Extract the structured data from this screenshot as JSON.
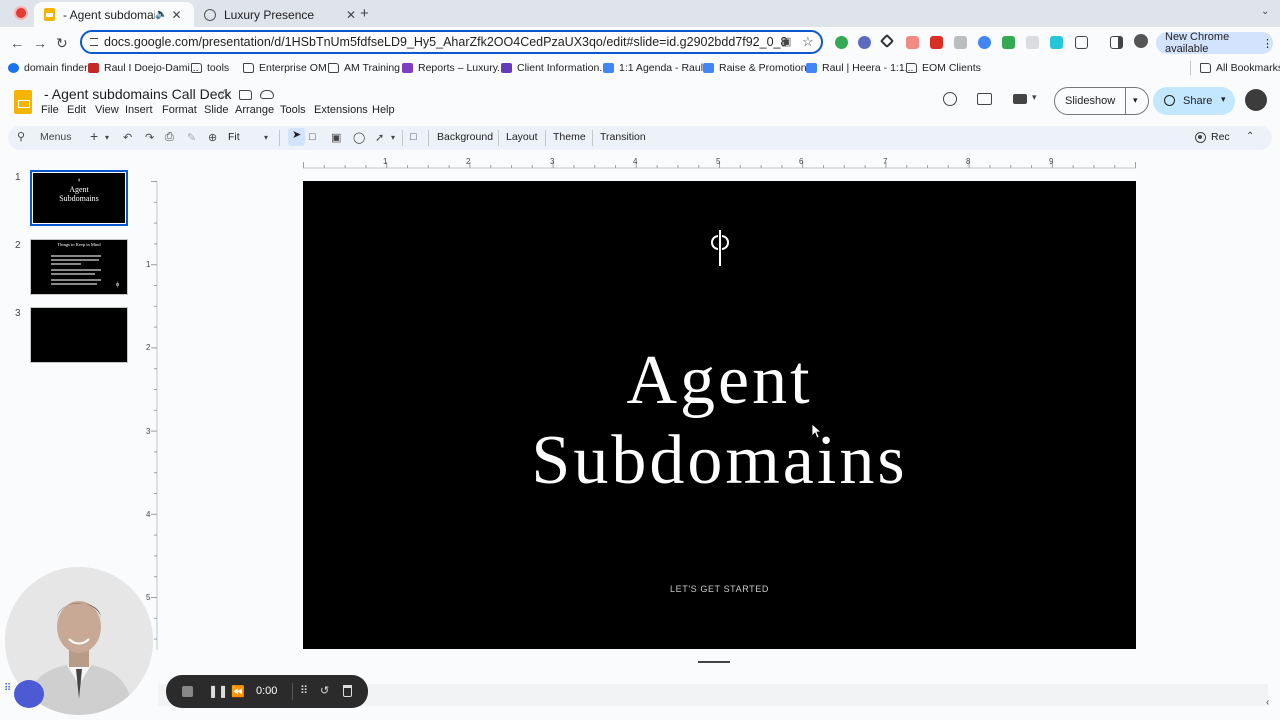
{
  "browser": {
    "tabs": [
      {
        "title": "- Agent subdomains Call",
        "active": true,
        "icon": "slides-icon",
        "extra_icon": "speaker-icon"
      },
      {
        "title": "Luxury Presence",
        "active": false,
        "icon": "globe-icon"
      }
    ],
    "url": "docs.google.com/presentation/d/1HSbTnUm5fdfseLD9_Hy5_AharZfk2OO4CedPzaUX3qo/edit#slide=id.g2902bdd7f92_0_8",
    "new_chrome_label": "New Chrome available",
    "bookmarks": [
      {
        "label": "domain finder",
        "icon": "blue"
      },
      {
        "label": "Raul I Doejo-Dami...",
        "icon": "red"
      },
      {
        "label": "tools",
        "icon": "folder"
      },
      {
        "label": "Enterprise OM",
        "icon": "folder"
      },
      {
        "label": "AM Training",
        "icon": "folder"
      },
      {
        "label": "Reports – Luxury...",
        "icon": "purple"
      },
      {
        "label": "Client Information...",
        "icon": "form"
      },
      {
        "label": "1:1 Agenda - Raul...",
        "icon": "doc"
      },
      {
        "label": "Raise & Promotion...",
        "icon": "doc"
      },
      {
        "label": "Raul | Heera - 1:1...",
        "icon": "doc"
      },
      {
        "label": "EOM Clients",
        "icon": "folder"
      }
    ],
    "all_bookmarks_label": "All Bookmarks"
  },
  "app": {
    "doc_title": "- Agent subdomains Call Deck",
    "menus": [
      "File",
      "Edit",
      "View",
      "Insert",
      "Format",
      "Slide",
      "Arrange",
      "Tools",
      "Extensions",
      "Help"
    ],
    "slideshow_label": "Slideshow",
    "share_label": "Share"
  },
  "toolbar": {
    "menus_label": "Menus",
    "zoom_label": "Fit",
    "background_label": "Background",
    "layout_label": "Layout",
    "theme_label": "Theme",
    "transition_label": "Transition",
    "rec_label": "Rec"
  },
  "filmstrip": {
    "slides": [
      {
        "number": "1",
        "title": "Agent Subdomains"
      },
      {
        "number": "2",
        "title": "Things to Keep in Mind"
      },
      {
        "number": "3",
        "title": ""
      }
    ]
  },
  "rulers": {
    "horizontal": [
      "1",
      "2",
      "3",
      "4",
      "5",
      "6",
      "7",
      "8",
      "9"
    ],
    "vertical": [
      "1",
      "2",
      "3",
      "4",
      "5"
    ]
  },
  "slide": {
    "title_line1": "Agent",
    "title_line2": "Subdomains",
    "subtitle": "LET'S GET STARTED",
    "background": "#000000",
    "text_color": "#ffffff"
  },
  "recorder": {
    "time": "0:00"
  },
  "colors": {
    "accent": "#0b57d0",
    "share_bg": "#c2e7ff"
  }
}
